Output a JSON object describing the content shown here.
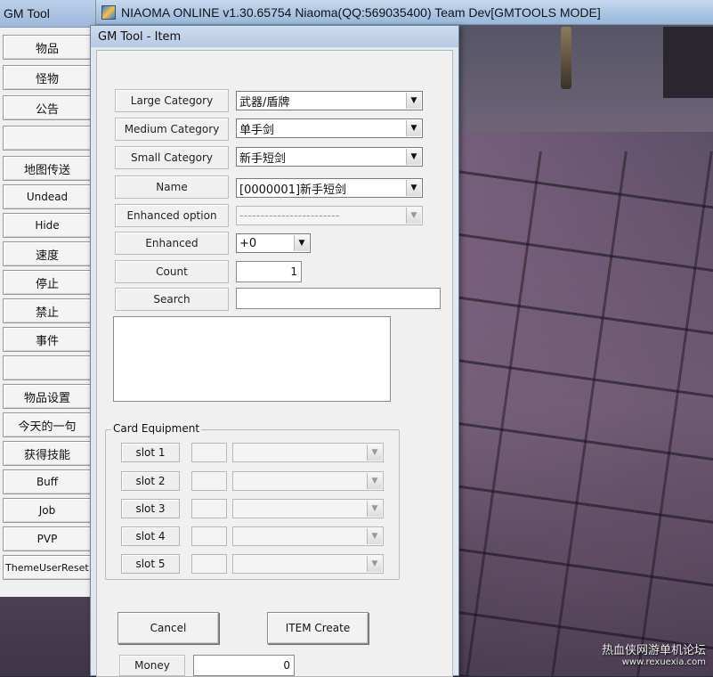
{
  "window": {
    "title": "NIAOMA ONLINE  v1.30.65754 Niaoma(QQ:569035400) Team Dev[GMTOOLS MODE]"
  },
  "sidebar": {
    "title": "GM Tool",
    "items": [
      {
        "label": "物品"
      },
      {
        "label": "怪物"
      },
      {
        "label": "公告"
      },
      {
        "label": "地图传送"
      },
      {
        "label": "Undead"
      },
      {
        "label": "Hide"
      },
      {
        "label": "速度"
      },
      {
        "label": "停止"
      },
      {
        "label": "禁止"
      },
      {
        "label": "事件"
      },
      {
        "label": "物品设置"
      },
      {
        "label": "今天的一句"
      },
      {
        "label": "获得技能"
      },
      {
        "label": "Buff"
      },
      {
        "label": "Job"
      },
      {
        "label": "PVP"
      },
      {
        "label": "ThemeUserReset"
      }
    ]
  },
  "dialog": {
    "title": "GM Tool - Item",
    "large_category": {
      "label": "Large Category",
      "value": "武器/盾牌"
    },
    "medium_category": {
      "label": "Medium Category",
      "value": "单手剑"
    },
    "small_category": {
      "label": "Small Category",
      "value": "新手短剑"
    },
    "name": {
      "label": "Name",
      "value": "[0000001]新手短剑"
    },
    "enhanced_option": {
      "label": "Enhanced option",
      "value": "------------------------"
    },
    "enhanced": {
      "label": "Enhanced",
      "value": "+0"
    },
    "count": {
      "label": "Count",
      "value": "1"
    },
    "search": {
      "label": "Search",
      "value": ""
    },
    "card_equipment": {
      "legend": "Card Equipment",
      "slots": [
        {
          "label": "slot 1"
        },
        {
          "label": "slot 2"
        },
        {
          "label": "slot 3"
        },
        {
          "label": "slot 4"
        },
        {
          "label": "slot 5"
        }
      ]
    },
    "cancel_label": "Cancel",
    "create_label": "ITEM Create",
    "money": {
      "label": "Money",
      "value": "0"
    }
  },
  "watermark": {
    "line1": "热血侠网游单机论坛",
    "line2": "www.rexuexia.com"
  }
}
